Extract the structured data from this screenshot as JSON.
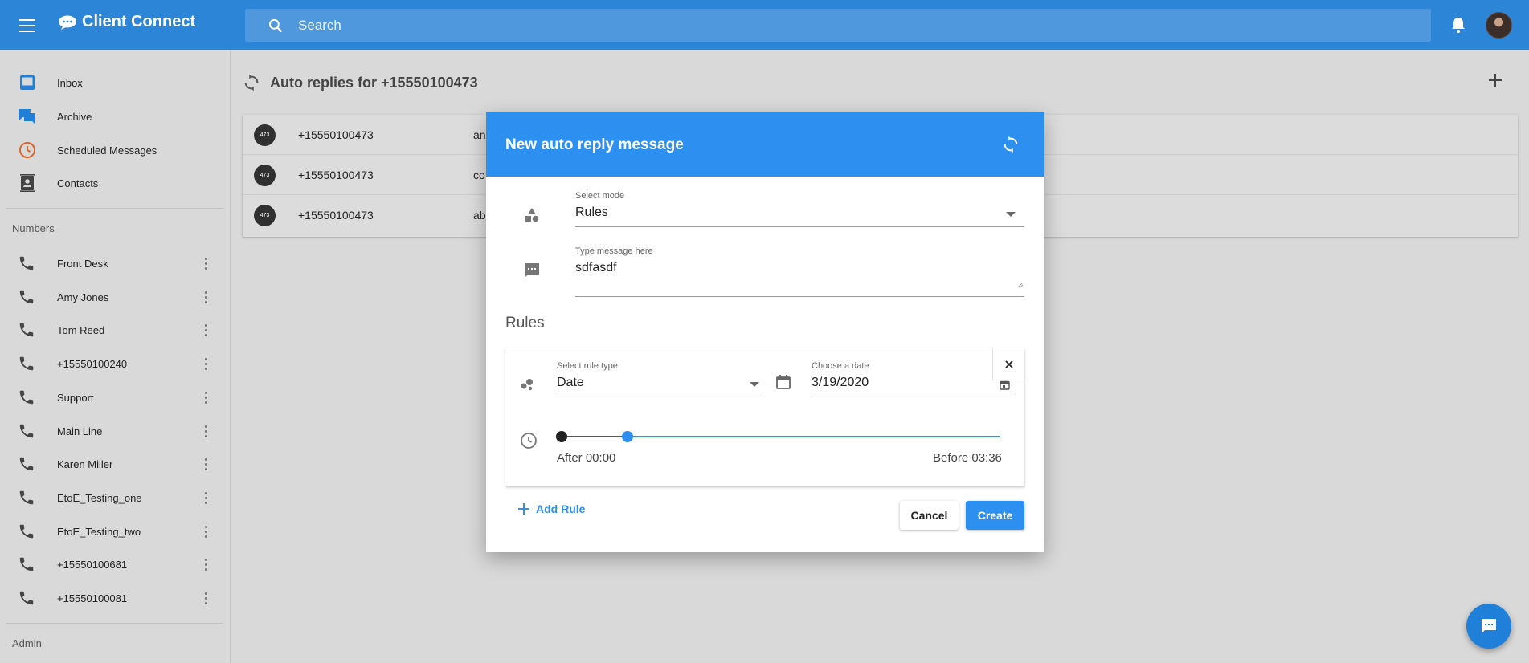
{
  "app": {
    "title": "Client Connect"
  },
  "search": {
    "placeholder": "Search"
  },
  "sidebar": {
    "nav": [
      {
        "label": "Inbox",
        "icon": "inbox-icon"
      },
      {
        "label": "Archive",
        "icon": "archive-icon"
      },
      {
        "label": "Scheduled Messages",
        "icon": "clock-icon"
      },
      {
        "label": "Contacts",
        "icon": "contacts-icon"
      }
    ],
    "numbers_title": "Numbers",
    "numbers": [
      {
        "label": "Front Desk"
      },
      {
        "label": "Amy Jones"
      },
      {
        "label": "Tom Reed"
      },
      {
        "label": "+15550100240"
      },
      {
        "label": "Support"
      },
      {
        "label": "Main Line"
      },
      {
        "label": "Karen Miller"
      },
      {
        "label": "EtoE_Testing_one"
      },
      {
        "label": "EtoE_Testing_two"
      },
      {
        "label": "+15550100681"
      },
      {
        "label": "+15550100081"
      }
    ],
    "admin_title": "Admin"
  },
  "main": {
    "title": "Auto replies for +15550100473",
    "rows": [
      {
        "badge": "473",
        "phone": "+15550100473",
        "message": "an"
      },
      {
        "badge": "473",
        "phone": "+15550100473",
        "message": "co"
      },
      {
        "badge": "473",
        "phone": "+15550100473",
        "message": "ab"
      }
    ]
  },
  "dialog": {
    "title": "New auto reply message",
    "mode": {
      "label": "Select mode",
      "value": "Rules"
    },
    "message": {
      "label": "Type message here",
      "value": "sdfasdf"
    },
    "rules_title": "Rules",
    "rule": {
      "type_label": "Select rule type",
      "type_value": "Date",
      "date_label": "Choose a date",
      "date_value": "3/19/2020",
      "after_label": "After 00:00",
      "before_label": "Before 03:36",
      "range_start_fraction": 0.0,
      "range_end_fraction": 0.15
    },
    "add_rule_label": "Add Rule",
    "cancel_label": "Cancel",
    "create_label": "Create"
  },
  "colors": {
    "primary": "#2d8ff0",
    "topbar": "#2d85d8",
    "scheduled_icon": "#e0632a"
  }
}
